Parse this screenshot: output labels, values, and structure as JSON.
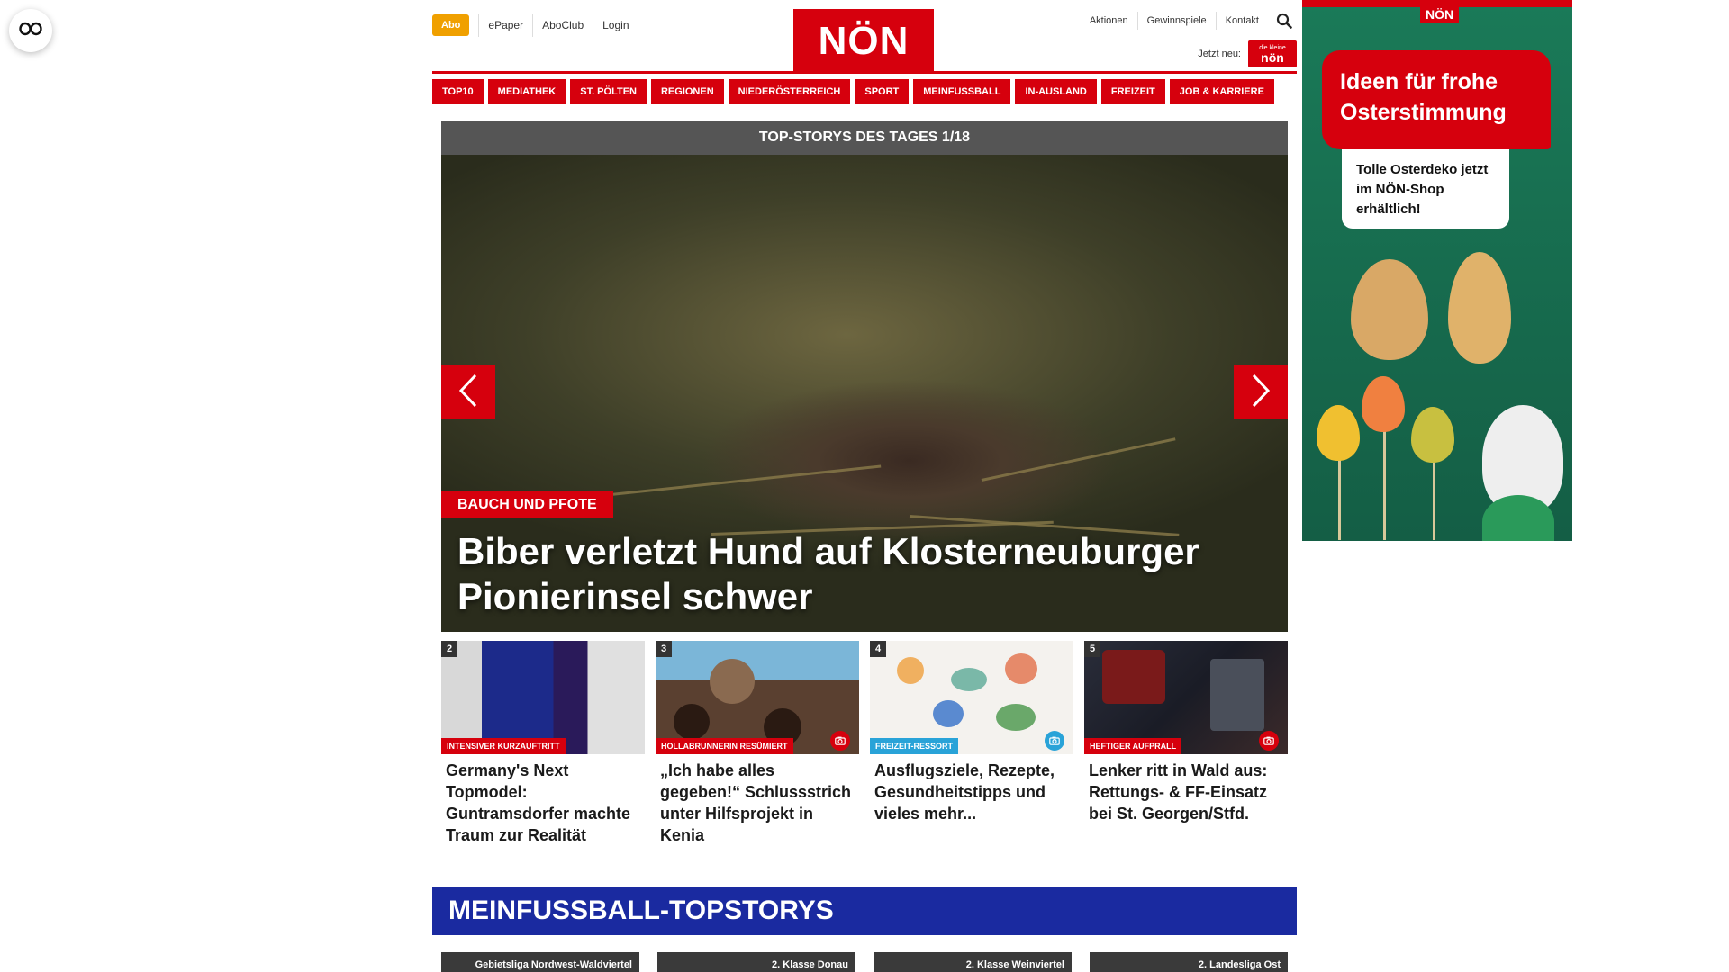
{
  "header": {
    "abo_label": "Abo",
    "links_left": [
      "ePaper",
      "AboClub",
      "Login"
    ],
    "logo_text": "NÖN",
    "links_right": [
      "Aktionen",
      "Gewinnspiele",
      "Kontakt"
    ],
    "jetzt_label": "Jetzt neu:",
    "app_badge_top": "die kleine",
    "app_badge_text": "nön"
  },
  "nav": [
    "TOP10",
    "MEDIATHEK",
    "ST. PÖLTEN",
    "REGIONEN",
    "NIEDERÖSTERREICH",
    "SPORT",
    "MEINFUSSBALL",
    "IN-AUSLAND",
    "FREIZEIT",
    "JOB & KARRIERE"
  ],
  "hero": {
    "header": "TOP-STORYS DES TAGES 1/18",
    "tag": "BAUCH UND PFOTE",
    "title": "Biber verletzt Hund auf Klosterneuburger Pionierinsel schwer"
  },
  "cards": [
    {
      "num": "2",
      "tag": "INTENSIVER KURZAUFTRITT",
      "title": "Germany's Next Topmodel: Guntramsdorfer machte Traum zur Realität"
    },
    {
      "num": "3",
      "tag": "HOLLABRUNNERIN RESÜMIERT",
      "title": "„Ich habe alles gegeben!“ Schlussstrich unter Hilfsprojekt in Kenia"
    },
    {
      "num": "4",
      "tag": "FREIZEIT-RESSORT",
      "title": "Ausflugsziele, Rezepte, Gesundheitstipps und vieles mehr..."
    },
    {
      "num": "5",
      "tag": "HEFTIGER AUFPRALL",
      "title": "Lenker ritt in Wald aus: Rettungs- & FF-Einsatz bei St. Georgen/Stfd."
    }
  ],
  "section": {
    "title": "MEINFUSSBALL-TOPSTORYS"
  },
  "teasers": [
    "Gebietsliga Nordwest-Waldviertel",
    "2. Klasse Donau",
    "2. Klasse Weinviertel",
    "2. Landesliga Ost"
  ],
  "ad": {
    "logo": "NÖN",
    "headline": "Ideen für frohe Osterstimmung",
    "subline": "Tolle Osterdeko jetzt im NÖN-Shop erhältlich!"
  },
  "colors": {
    "brand_red": "#d6000d",
    "abo_orange": "#f0a000",
    "section_blue": "#1a2aa0",
    "tag_blue": "#29a3d8",
    "ad_green": "#1a7a58"
  },
  "icons": [
    "accessibility-icon",
    "search-icon",
    "chevron-left-icon",
    "chevron-right-icon",
    "camera-icon"
  ]
}
